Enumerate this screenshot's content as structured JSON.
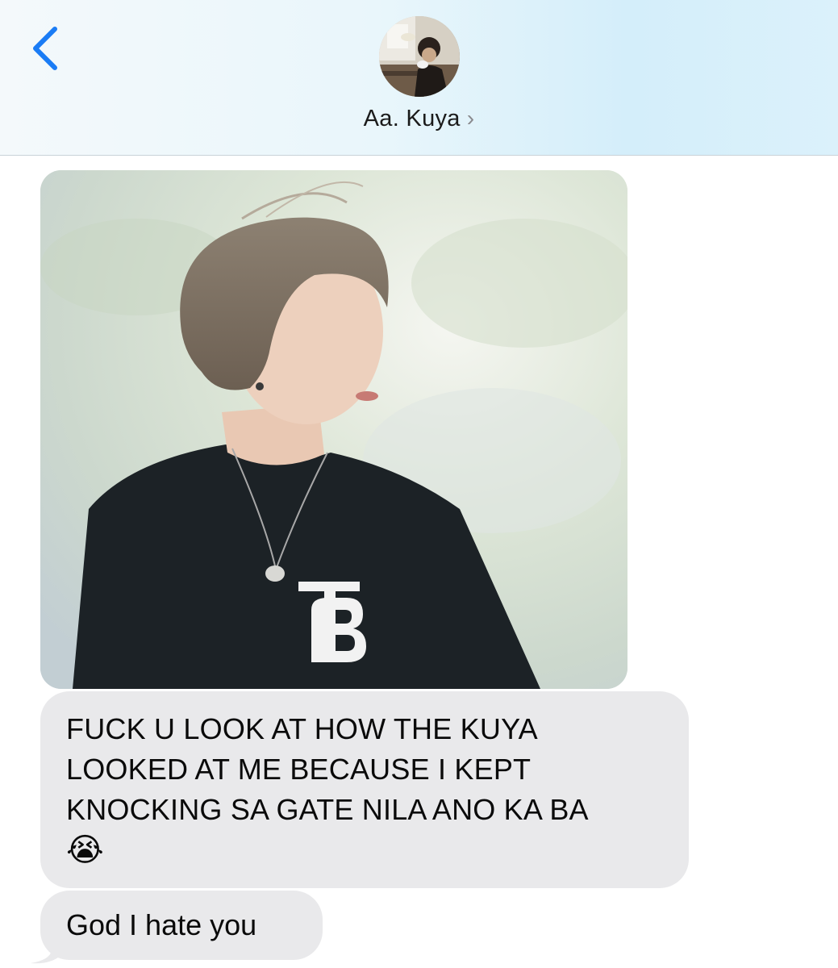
{
  "header": {
    "back_icon": "chevron-left-icon",
    "contact_name": "Aa. Kuya",
    "contact_chevron": "›",
    "accent_color": "#1a7cf5"
  },
  "messages": [
    {
      "type": "image",
      "description_icon": "photo"
    },
    {
      "type": "text",
      "text": "FUCK U LOOK AT HOW THE KUYA\nLOOKED AT ME BECAUSE I KEPT\nKNOCKING SA GATE NILA ANO KA BA",
      "emoji": "😭"
    },
    {
      "type": "text",
      "text": "God I hate you"
    }
  ],
  "colors": {
    "bubble_received": "#e9e9eb"
  }
}
